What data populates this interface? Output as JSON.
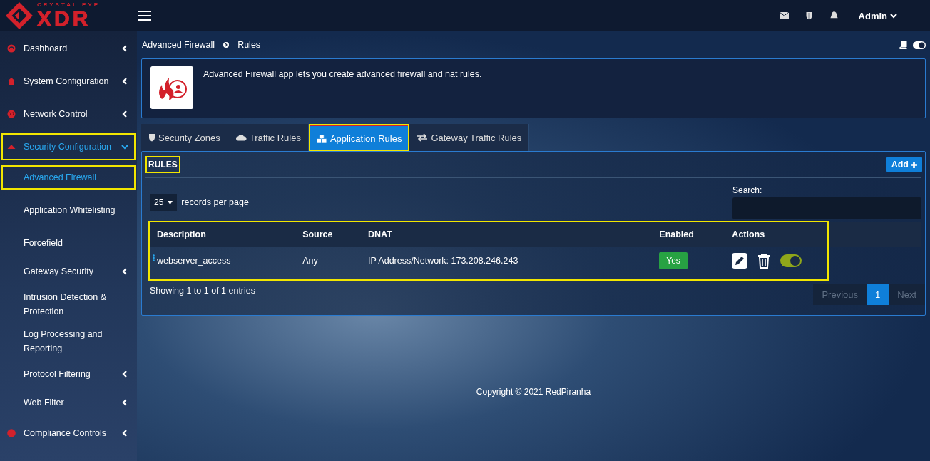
{
  "logo": {
    "top": "CRYSTAL EYE",
    "main": "XDR"
  },
  "header": {
    "user": "Admin"
  },
  "sidebar": {
    "items": [
      {
        "label": "Dashboard",
        "kind": "group",
        "expanded": false,
        "selected": false,
        "highlighted": false
      },
      {
        "label": "System Configuration",
        "kind": "group",
        "expanded": false,
        "selected": false,
        "highlighted": false
      },
      {
        "label": "Network Control",
        "kind": "group",
        "expanded": false,
        "selected": false,
        "highlighted": false
      },
      {
        "label": "Security Configuration",
        "kind": "group",
        "expanded": true,
        "selected": true,
        "highlighted": true,
        "children": [
          {
            "label": "Advanced Firewall",
            "kind": "link",
            "selected": true,
            "highlighted": true
          },
          {
            "label": "Application Whitelisting",
            "kind": "link",
            "selected": false,
            "highlighted": false
          },
          {
            "label": "Forcefield",
            "kind": "link",
            "selected": false,
            "highlighted": false
          },
          {
            "label": "Gateway Security",
            "kind": "group",
            "expanded": false,
            "selected": false,
            "highlighted": false
          },
          {
            "label": "Intrusion Detection & Protection",
            "kind": "link",
            "selected": false,
            "highlighted": false
          },
          {
            "label": "Log Processing and Reporting",
            "kind": "link",
            "selected": false,
            "highlighted": false
          },
          {
            "label": "Protocol Filtering",
            "kind": "group",
            "expanded": false,
            "selected": false,
            "highlighted": false
          },
          {
            "label": "Web Filter",
            "kind": "group",
            "expanded": false,
            "selected": false,
            "highlighted": false
          }
        ]
      },
      {
        "label": "Compliance Controls",
        "kind": "group",
        "expanded": false,
        "selected": false,
        "highlighted": false
      }
    ]
  },
  "breadcrumb": [
    "Advanced Firewall",
    "Rules"
  ],
  "intro": {
    "text": "Advanced Firewall app lets you create advanced firewall and nat rules."
  },
  "tabs": [
    {
      "label": "Security Zones",
      "selected": false,
      "highlighted": false
    },
    {
      "label": "Traffic Rules",
      "selected": false,
      "highlighted": false
    },
    {
      "label": "Application Rules",
      "selected": true,
      "highlighted": true
    },
    {
      "label": "Gateway Traffic Rules",
      "selected": false,
      "highlighted": false
    }
  ],
  "panel": {
    "title": "RULES",
    "title_highlighted": true,
    "add_button": "Add",
    "page_size": "25",
    "page_size_label": "records per page",
    "search_label": "Search:"
  },
  "table": {
    "highlighted": true,
    "columns": [
      "Description",
      "Source",
      "DNAT",
      "Enabled",
      "Actions"
    ],
    "rows": [
      {
        "description": "webserver_access",
        "source": "Any",
        "dnat": "IP Address/Network: 173.208.246.243",
        "enabled_label": "Yes",
        "enabled": true
      }
    ]
  },
  "footer_info": "Showing 1 to 1 of 1 entries",
  "pagination": [
    {
      "label": "Previous",
      "selected": false,
      "disabled": true
    },
    {
      "label": "1",
      "selected": true,
      "disabled": false
    },
    {
      "label": "Next",
      "selected": false,
      "disabled": true
    }
  ],
  "copyright": "Copyright © 2021 RedPiranha"
}
